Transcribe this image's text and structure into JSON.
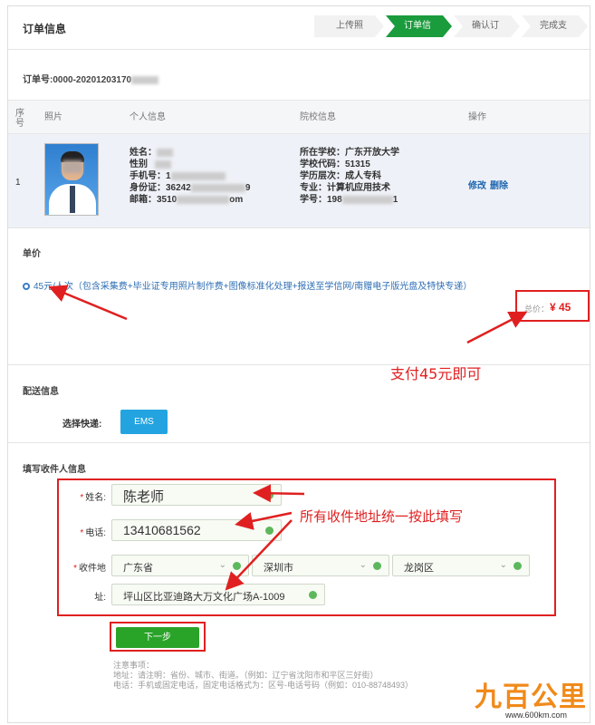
{
  "header": {
    "title": "订单信息",
    "steps": [
      "上传照片",
      "订单信息",
      "确认订单",
      "完成支付"
    ]
  },
  "order": {
    "number": "订单号:0000-20201203170"
  },
  "table": {
    "headers": {
      "index": "序号",
      "photo": "照片",
      "personal": "个人信息",
      "school": "院校信息",
      "action": "操作"
    },
    "row": {
      "index": "1",
      "personal": [
        "姓名：",
        "性别",
        "手机号：1",
        "身份证：36242",
        "邮箱：3510"
      ],
      "personal_tails": [
        "",
        "",
        "",
        "9",
        "om"
      ],
      "school": [
        "所在学校：广东开放大学",
        "学校代码：51315",
        "学历层次：成人专科",
        "专业：计算机应用技术",
        "学号：198"
      ],
      "school_tails": [
        "",
        "",
        "",
        "",
        "1"
      ],
      "edit": "修改",
      "delete": "删除"
    }
  },
  "price": {
    "section_label": "单价",
    "description": "45元/人次（包含采集费+毕业证专用照片制作费+图像标准化处理+报送至学信网/南赠电子版光盘及特快专递）",
    "total_label": "总价：",
    "total_value": "¥ 45"
  },
  "annotations": {
    "pay_note": "支付45元即可",
    "address_note": "所有收件地址统一按此填写"
  },
  "delivery": {
    "section_label": "配送信息",
    "select_label": "选择快递:",
    "courier": "EMS"
  },
  "recipient": {
    "section_label": "填写收件人信息",
    "name_label": "姓名:",
    "name_value": "陈老师",
    "phone_label": "电话:",
    "phone_value": "13410681562",
    "address_label": "收件地",
    "address_label2": "址:",
    "province": "广东省",
    "city": "深圳市",
    "district": "龙岗区",
    "street": "坪山区比亚迪路大万文化广场A-1009"
  },
  "actions": {
    "next": "下一步"
  },
  "notes": [
    "注意事项：",
    "地址：请注明：省份、城市、街道。（例如：辽宁省沈阳市和平区三好街）",
    "电话：手机或固定电话，固定电话格式为：区号-电话号码（例如：010-88748493）"
  ],
  "logo": {
    "text": "九百公里",
    "url": "www.600km.com"
  },
  "colors": {
    "accent_green": "#1a9b3c",
    "annotation_red": "#e02020",
    "link_blue": "#1f67b1",
    "ems_blue": "#23a4e0"
  }
}
